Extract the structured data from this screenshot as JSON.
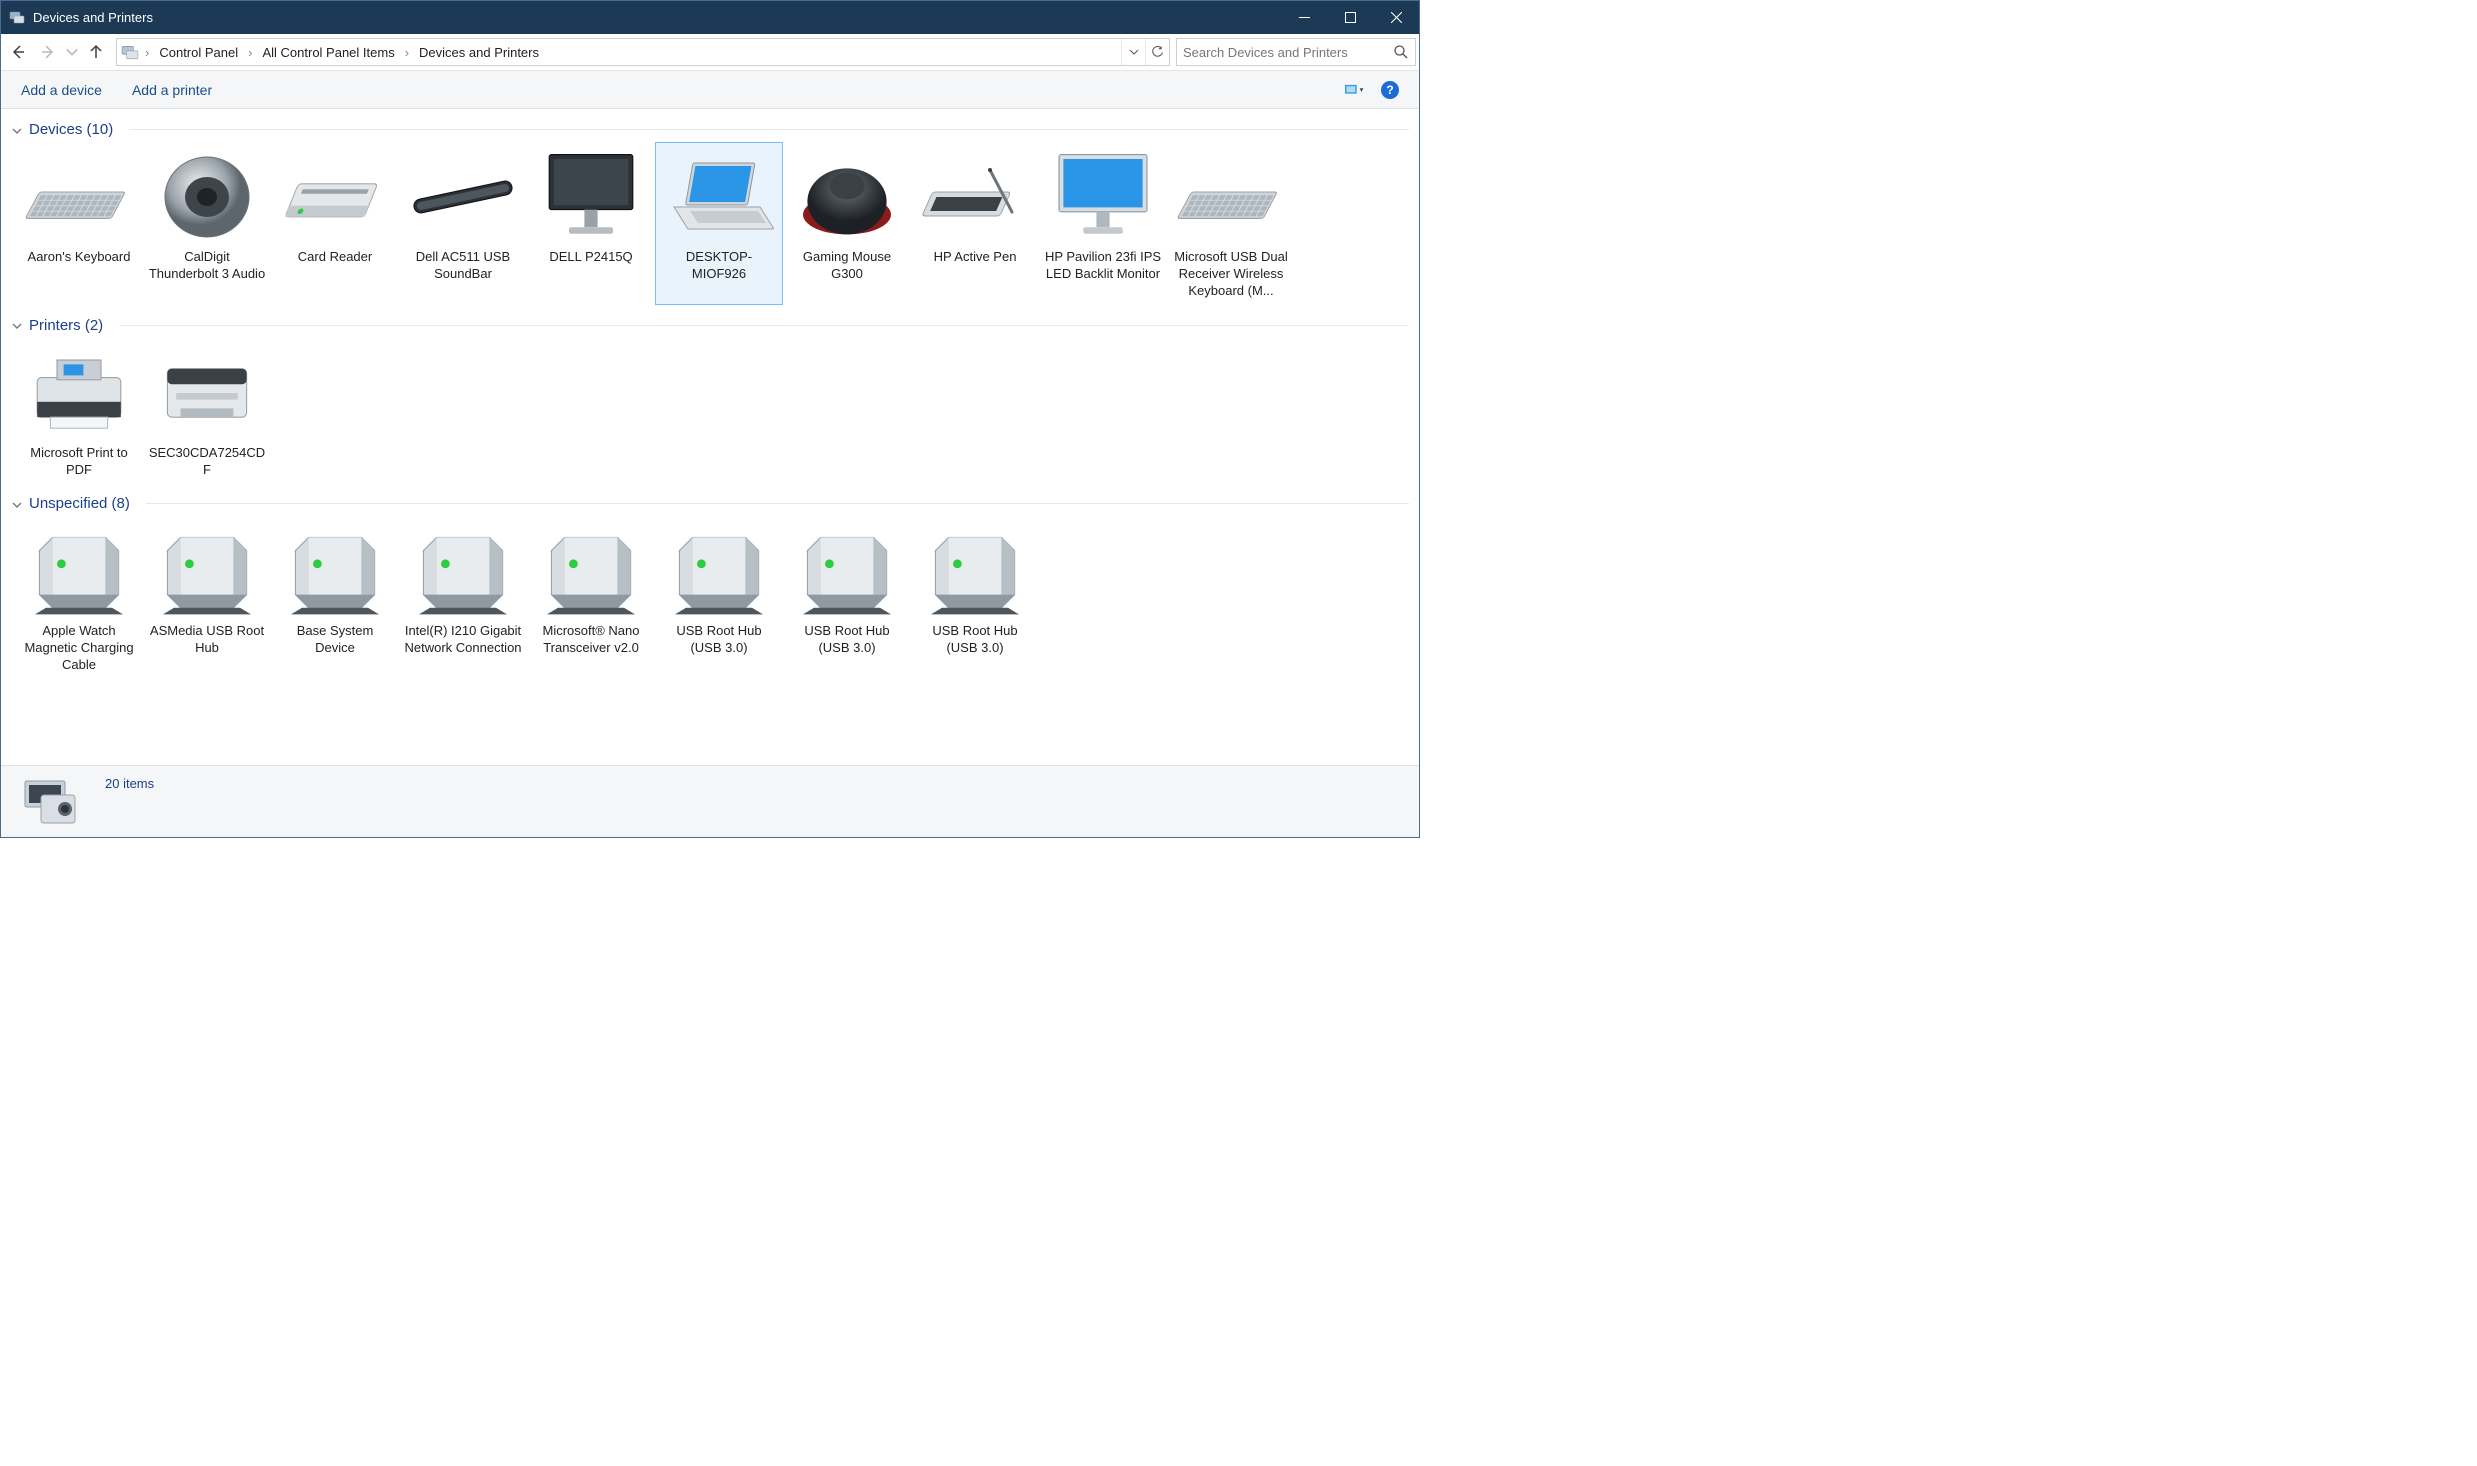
{
  "title": "Devices and Printers",
  "breadcrumb": [
    "Control Panel",
    "All Control Panel Items",
    "Devices and Printers"
  ],
  "search_placeholder": "Search Devices and Printers",
  "toolbar": {
    "add_device": "Add a device",
    "add_printer": "Add a printer"
  },
  "groups": [
    {
      "name": "Devices",
      "count": 10,
      "items": [
        {
          "label": "Aaron's Keyboard",
          "icon": "keyboard",
          "selected": false
        },
        {
          "label": "CalDigit Thunderbolt 3 Audio",
          "icon": "speaker",
          "selected": false
        },
        {
          "label": "Card Reader",
          "icon": "cardreader",
          "selected": false
        },
        {
          "label": "Dell AC511 USB SoundBar",
          "icon": "soundbar",
          "selected": false
        },
        {
          "label": "DELL P2415Q",
          "icon": "monitor-dark",
          "selected": false
        },
        {
          "label": "DESKTOP-MIOF926",
          "icon": "laptop",
          "selected": true
        },
        {
          "label": "Gaming Mouse G300",
          "icon": "mouse",
          "selected": false
        },
        {
          "label": "HP Active Pen",
          "icon": "pen-tablet",
          "selected": false
        },
        {
          "label": "HP Pavilion 23fi IPS LED Backlit Monitor",
          "icon": "monitor-blue",
          "selected": false
        },
        {
          "label": "Microsoft USB Dual Receiver Wireless Keyboard (M...",
          "icon": "keyboard",
          "selected": false
        }
      ]
    },
    {
      "name": "Printers",
      "count": 2,
      "items": [
        {
          "label": "Microsoft Print to PDF",
          "icon": "printer-inkjet",
          "selected": false
        },
        {
          "label": "SEC30CDA7254CDF",
          "icon": "printer-laser",
          "selected": false
        }
      ]
    },
    {
      "name": "Unspecified",
      "count": 8,
      "items": [
        {
          "label": "Apple Watch Magnetic Charging Cable",
          "icon": "generic-device",
          "selected": false
        },
        {
          "label": "ASMedia USB Root Hub",
          "icon": "generic-device",
          "selected": false
        },
        {
          "label": "Base System Device",
          "icon": "generic-device",
          "selected": false
        },
        {
          "label": "Intel(R) I210 Gigabit Network Connection",
          "icon": "generic-device",
          "selected": false
        },
        {
          "label": "Microsoft® Nano Transceiver v2.0",
          "icon": "generic-device",
          "selected": false
        },
        {
          "label": "USB Root Hub (USB 3.0)",
          "icon": "generic-device",
          "selected": false
        },
        {
          "label": "USB Root Hub (USB 3.0)",
          "icon": "generic-device",
          "selected": false
        },
        {
          "label": "USB Root Hub (USB 3.0)",
          "icon": "generic-device",
          "selected": false
        }
      ]
    }
  ],
  "status": {
    "count_text": "20 items"
  }
}
